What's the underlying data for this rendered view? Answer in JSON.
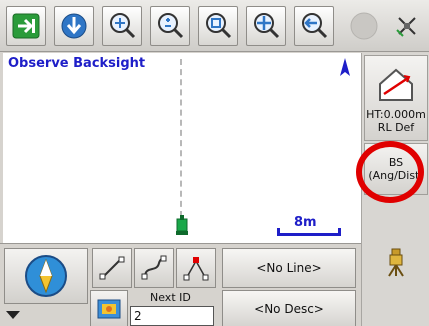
{
  "toolbar": {
    "buttons": [
      {
        "name": "exit-arrow-icon"
      },
      {
        "name": "settings-download-icon"
      },
      {
        "name": "zoom-pan-icon"
      },
      {
        "name": "zoom-in-out-icon"
      },
      {
        "name": "zoom-window-icon"
      },
      {
        "name": "zoom-extents-icon"
      },
      {
        "name": "zoom-previous-icon"
      },
      {
        "name": "status-indicator-icon"
      },
      {
        "name": "satellite-icon"
      }
    ]
  },
  "map": {
    "title": "Observe Backsight",
    "scale_label": "8m"
  },
  "right_panel": {
    "height_text": "HT:0.000m",
    "rl_text": "RL Def",
    "bs_label": "BS",
    "bs_mode": "(Ang/Dist)"
  },
  "bottom": {
    "next_id_label": "Next ID",
    "next_id_value": "2",
    "line_label": "<No Line>",
    "desc_label": "<No Desc>"
  },
  "colors": {
    "map_text": "#1e1ec8",
    "highlight_circle": "#e00000",
    "instrument": "#1aa84a"
  }
}
